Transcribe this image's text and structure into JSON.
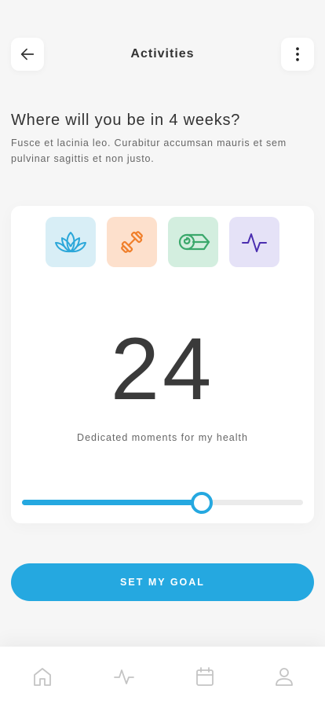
{
  "header": {
    "title": "Activities",
    "back_icon": "arrow-left-icon",
    "more_icon": "more-vertical-icon"
  },
  "intro": {
    "headline": "Where will you be in 4 weeks?",
    "description": "Fusce et lacinia leo. Curabitur accumsan mauris et sem pulvinar sagittis et non justo."
  },
  "activities": [
    {
      "icon": "lotus-icon",
      "color": "#2ba7d9",
      "bg": "#d8eef6"
    },
    {
      "icon": "dumbbell-icon",
      "color": "#f07f2b",
      "bg": "#fde0cc"
    },
    {
      "icon": "yoga-mat-icon",
      "color": "#3aa86b",
      "bg": "#d3eedf"
    },
    {
      "icon": "pulse-icon",
      "color": "#4a2eb0",
      "bg": "#e5e2f7"
    }
  ],
  "goal": {
    "count": "24",
    "label": "Dedicated moments for my health",
    "slider_fraction": 0.64
  },
  "cta": {
    "label": "SET MY GOAL"
  },
  "colors": {
    "accent": "#25a8e0",
    "background": "#f6f6f6"
  },
  "tabbar": {
    "items": [
      {
        "icon": "home-icon"
      },
      {
        "icon": "activity-icon"
      },
      {
        "icon": "calendar-icon"
      },
      {
        "icon": "profile-icon"
      }
    ]
  }
}
